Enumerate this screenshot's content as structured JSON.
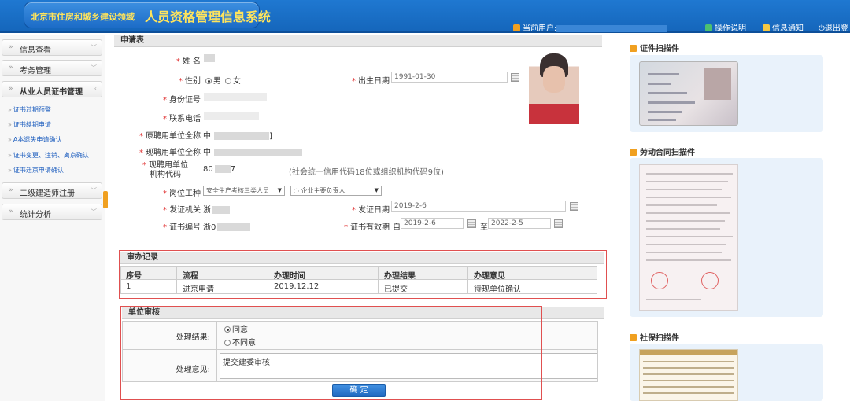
{
  "header": {
    "org_name": "北京市住房和城乡建设领域",
    "system_name": "人员资格管理信息系统",
    "current_user_label": "当前用户:",
    "help_label": "操作说明",
    "notify_label": "信息通知",
    "logout_label": "退出登"
  },
  "sidebar": {
    "groups": [
      {
        "label": "信息查看"
      },
      {
        "label": "考务管理"
      },
      {
        "label": "从业人员证书管理"
      },
      {
        "label": "二级建造师注册"
      },
      {
        "label": "统计分析"
      }
    ],
    "sub_items": [
      {
        "label": "证书过期预警"
      },
      {
        "label": "证书续期申请"
      },
      {
        "label": "A本遗失申请确认"
      },
      {
        "label": "证书变更、注销、离京确认"
      },
      {
        "label": "证书迁京申请确认"
      }
    ]
  },
  "form": {
    "section_title": "申请表",
    "name_label": "姓 名",
    "gender_label": "性别",
    "gender_male": "男",
    "gender_female": "女",
    "birth_label": "出生日期",
    "birth_value": "1991-01-30",
    "id_label": "身份证号",
    "phone_label": "联系电话",
    "prev_unit_label": "原聘用单位全称",
    "prev_unit_value": "中",
    "prev_unit_suffix": "]",
    "curr_unit_label": "现聘用单位全称",
    "curr_unit_value": "中",
    "org_code_label_1": "现聘用单位",
    "org_code_label_2": "机构代码",
    "org_code_value": "80",
    "org_code_suffix": "7",
    "org_code_hint": "(社会统一信用代码18位或组织机构代码9位)",
    "post_label": "岗位工种",
    "post_select_1": "安全生产考核三类人员",
    "post_select_2": "企业主要负责人",
    "issuer_label": "发证机关",
    "issuer_value": "浙",
    "issue_date_label": "发证日期",
    "issue_date_value": "2019-2-6",
    "cert_no_label": "证书编号",
    "cert_no_value": "浙0",
    "valid_label": "证书有效期",
    "valid_from_prefix": "自",
    "valid_from": "2019-2-6",
    "valid_to_prefix": "至",
    "valid_to": "2022-2-5"
  },
  "records": {
    "section_title": "审办记录",
    "columns": [
      "序号",
      "流程",
      "办理时间",
      "办理结果",
      "办理意见"
    ],
    "rows": [
      [
        "1",
        "进京申请",
        "2019.12.12",
        "已提交",
        "待现单位确认"
      ]
    ]
  },
  "review": {
    "section_title": "单位审核",
    "result_label": "处理结果:",
    "opt_agree": "同意",
    "opt_disagree": "不同意",
    "opinion_label": "处理意见:",
    "opinion_value": "提交建委审核",
    "confirm_label": "确 定"
  },
  "right_panel": {
    "cert_scan_title": "证件扫描件",
    "contract_scan_title": "劳动合同扫描件",
    "social_scan_title": "社保扫描件"
  },
  "colors": {
    "header_blue": "#1f78d1",
    "logo_yellow": "#ffe45c",
    "highlight_red": "#e05050",
    "accent_orange": "#f0a020",
    "link_blue": "#1f5fbf"
  }
}
